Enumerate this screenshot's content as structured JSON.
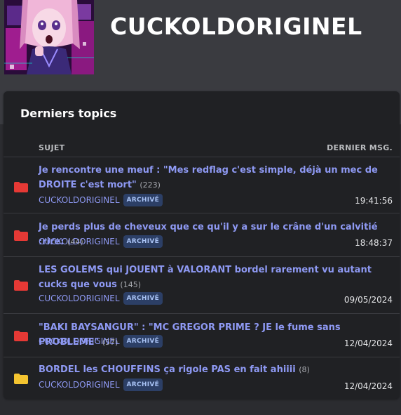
{
  "profile": {
    "username": "CUCKOLDORIGINEL"
  },
  "card": {
    "title": "Derniers topics",
    "col_subject": "SUJET",
    "col_last": "DERNIER MSG."
  },
  "colors": {
    "link": "#8e99f3",
    "folder_red": "#e53935",
    "folder_yellow": "#f4c430",
    "badge_bg": "#2c3f66"
  },
  "topics": [
    {
      "title": "Je rencontre une meuf : \"Mes redflag c'est simple, déjà un mec de DROITE c'est mort\"",
      "count": "(223)",
      "author": "CUCKOLDORIGINEL",
      "badge": "ARCHIVÉ",
      "last": "19:41:56",
      "folder": "red-folder-icon"
    },
    {
      "title": "Je perds plus de cheveux que ce qu'il y a sur le crâne d'un calvitié :rire:",
      "count": "(44)",
      "author": "CUCKOLDORIGINEL",
      "badge": "ARCHIVÉ",
      "last": "18:48:37",
      "folder": "red-folder-icon"
    },
    {
      "title": "LES GOLEMS qui JOUENT à VALORANT bordel rarement vu autant cucks que vous",
      "count": "(145)",
      "author": "CUCKOLDORIGINEL",
      "badge": "ARCHIVÉ",
      "last": "09/05/2024",
      "folder": "red-folder-icon"
    },
    {
      "title": "\"BAKI BAYSANGUR\" : \"MC GREGOR PRIME ? JE le fume sans PROBLEME\"",
      "count": "(57)",
      "author": "CUCKOLDORIGINEL",
      "badge": "ARCHIVÉ",
      "last": "12/04/2024",
      "folder": "red-folder-icon"
    },
    {
      "title": "BORDEL les CHOUFFINS ça rigole PAS en fait ahiiii",
      "count": "(8)",
      "author": "CUCKOLDORIGINEL",
      "badge": "ARCHIVÉ",
      "last": "12/04/2024",
      "folder": "yellow-folder-icon"
    }
  ]
}
